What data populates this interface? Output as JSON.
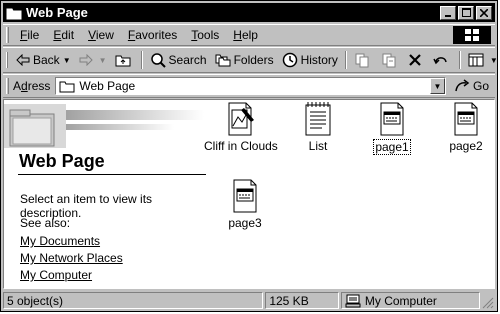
{
  "window": {
    "title": "Web Page"
  },
  "menu": {
    "items": [
      {
        "label": "File",
        "accel": "F",
        "rest": "ile"
      },
      {
        "label": "Edit",
        "accel": "E",
        "rest": "dit"
      },
      {
        "label": "View",
        "accel": "V",
        "rest": "iew"
      },
      {
        "label": "Favorites",
        "accel": "F",
        "rest": "avorites"
      },
      {
        "label": "Tools",
        "accel": "T",
        "rest": "ools"
      },
      {
        "label": "Help",
        "accel": "H",
        "rest": "elp"
      }
    ]
  },
  "toolbar": {
    "back_label": "Back",
    "search_label": "Search",
    "folders_label": "Folders",
    "history_label": "History"
  },
  "address": {
    "label_accel": "d",
    "label_pre": "A",
    "label_post": "ress",
    "value": "Web Page",
    "go_label": "Go"
  },
  "panel": {
    "title": "Web Page",
    "description": "Select an item to view its description.",
    "see_also": "See also:",
    "links": [
      "My Documents",
      "My Network Places",
      "My Computer"
    ]
  },
  "files": [
    {
      "name": "Cliff in Clouds",
      "icon": "image-document-icon"
    },
    {
      "name": "List",
      "icon": "text-document-icon"
    },
    {
      "name": "page1",
      "icon": "html-document-icon"
    },
    {
      "name": "page2",
      "icon": "html-document-icon"
    },
    {
      "name": "page3",
      "icon": "html-document-icon"
    }
  ],
  "status": {
    "objects": "5 object(s)",
    "size": "125 KB",
    "zone": "My Computer"
  }
}
